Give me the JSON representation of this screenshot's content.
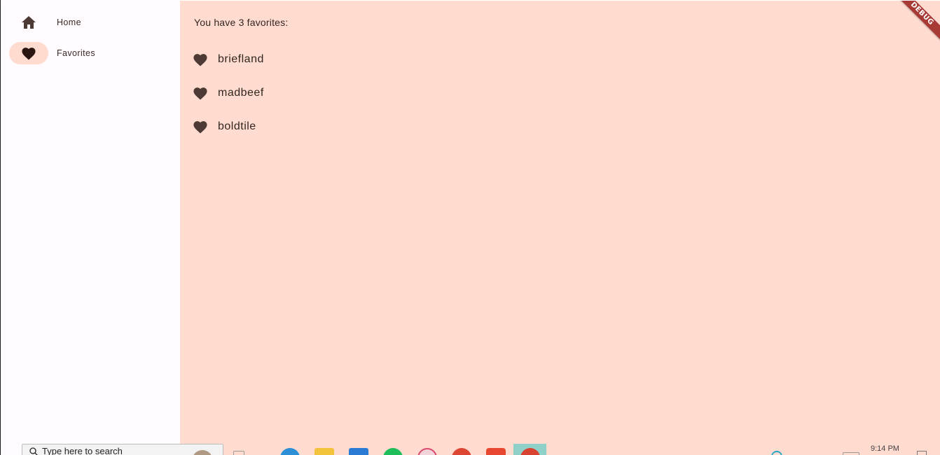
{
  "rail": {
    "items": [
      {
        "label": "Home",
        "icon": "home-icon",
        "selected": false
      },
      {
        "label": "Favorites",
        "icon": "heart-icon",
        "selected": true
      }
    ]
  },
  "main": {
    "count_text": "You have 3 favorites:",
    "favorites": [
      {
        "word": "briefland",
        "icon": "heart-icon"
      },
      {
        "word": "madbeef",
        "icon": "heart-icon"
      },
      {
        "word": "boldtile",
        "icon": "heart-icon"
      }
    ]
  },
  "debug_banner": "DEBUG",
  "taskbar": {
    "search_text": "Type here to search",
    "time": "9:14 PM"
  },
  "colors": {
    "rail_background": "#fffbff",
    "main_background": "#ffdbd0",
    "selected_indicator": "#ffdbd0",
    "icon": "#4e3a34",
    "debug_banner": "#a83a36"
  }
}
